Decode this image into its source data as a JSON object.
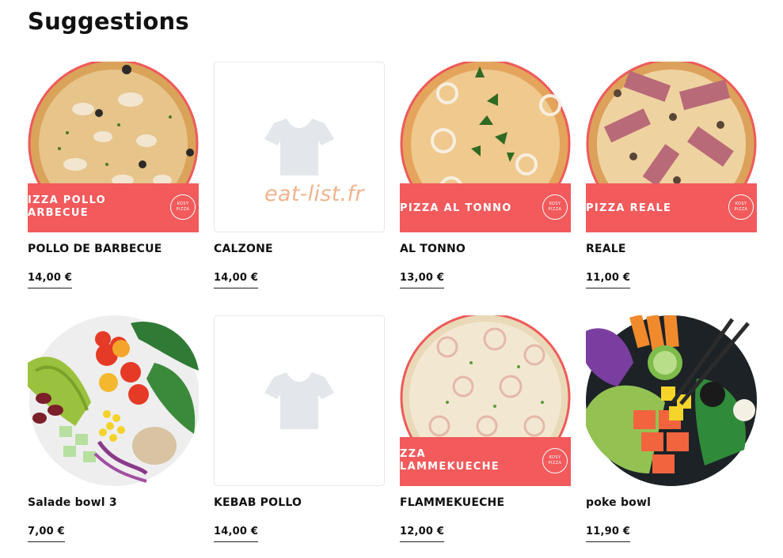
{
  "page": {
    "title": "Suggestions",
    "watermark": "eat-list.fr"
  },
  "products": [
    {
      "name": "POLLO DE BARBECUE",
      "price": "14,00 €",
      "image": "pizza-photo",
      "promo_text": "IZZA POLLO\nARBECUE",
      "badge": "KOSY\nPIZZA"
    },
    {
      "name": "CALZONE",
      "price": "14,00 €",
      "image": "placeholder-tshirt-icon"
    },
    {
      "name": "AL TONNO",
      "price": "13,00 €",
      "image": "pizza-photo",
      "promo_text": "PIZZA AL TONNO",
      "badge": "KOSY\nPIZZA"
    },
    {
      "name": "REALE",
      "price": "11,00 €",
      "image": "pizza-photo",
      "promo_text": "PIZZA REALE",
      "badge": "KOSY\nPIZZA"
    },
    {
      "name": "Salade bowl 3",
      "price": "7,00 €",
      "image": "salad-bowl-photo"
    },
    {
      "name": "KEBAB POLLO",
      "price": "14,00 €",
      "image": "placeholder-tshirt-icon"
    },
    {
      "name": "FLAMMEKUECHE",
      "price": "12,00 €",
      "image": "pizza-photo",
      "promo_text": "ZZA\nLAMMEKUECHE",
      "badge": "KOSY\nPIZZA"
    },
    {
      "name": "poke bowl",
      "price": "11,90 €",
      "image": "poke-bowl-photo"
    }
  ],
  "colors": {
    "promo_bar": "#f25a5c",
    "placeholder_icon": "#e3e6ea",
    "watermark": "#f0b48f"
  }
}
